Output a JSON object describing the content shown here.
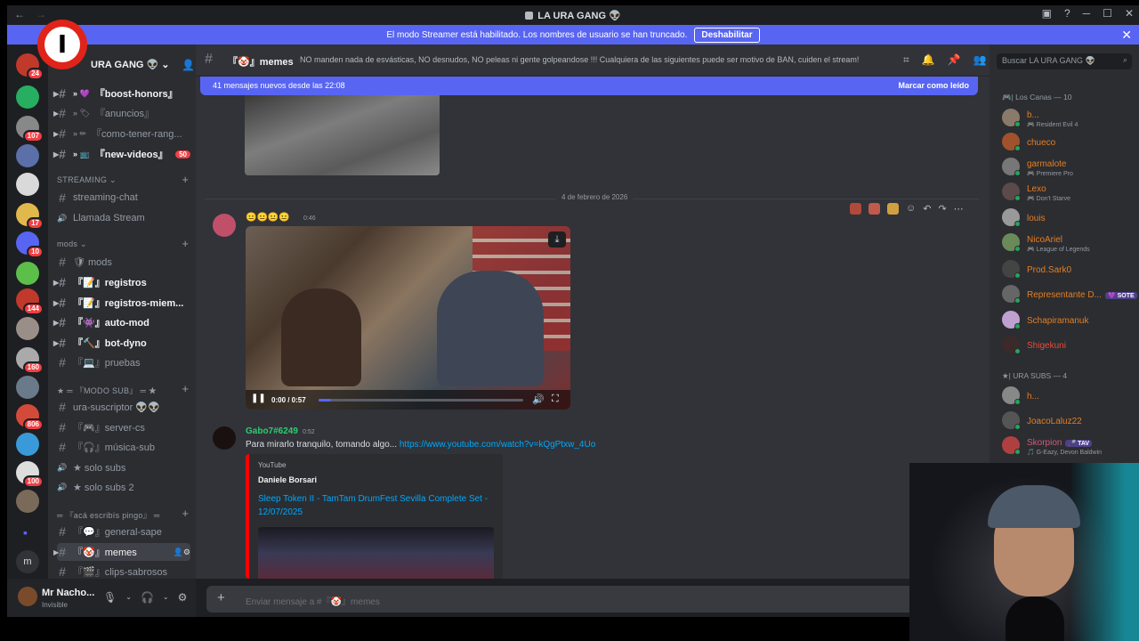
{
  "window": {
    "title": "LA URA GANG 👽",
    "back": "←",
    "forward": "→"
  },
  "banner": {
    "text": "El modo Streamer está habilitado. Los nombres de usuario se han truncado.",
    "button": "Deshabilitar",
    "close": "✕"
  },
  "guilds": [
    {
      "color": "#c0392b",
      "badge": "24"
    },
    {
      "color": "#27ae60",
      "badge": ""
    },
    {
      "color": "#888888",
      "badge": "107"
    },
    {
      "color": "#5b6fa8",
      "badge": ""
    },
    {
      "color": "#d9d9d9",
      "badge": ""
    },
    {
      "color": "#e1b84b",
      "badge": "17"
    },
    {
      "color": "#5865f2",
      "badge": "10"
    },
    {
      "color": "#5bbf4a",
      "badge": ""
    },
    {
      "color": "#c0392b",
      "badge": "144"
    },
    {
      "color": "#9a8f88",
      "badge": ""
    },
    {
      "color": "#aaaaaa",
      "badge": "160"
    },
    {
      "color": "#6a7a8a",
      "badge": ""
    },
    {
      "color": "#d44a3a",
      "badge": "806"
    },
    {
      "color": "#3a9ad9",
      "badge": ""
    },
    {
      "color": "#dddddd",
      "badge": "100"
    },
    {
      "color": "#7a6a5a",
      "badge": ""
    }
  ],
  "guild_extra": {
    "folder": "▪",
    "m": "m"
  },
  "server": {
    "name": "URA GANG 👽"
  },
  "sidebar": {
    "channels": [
      {
        "label": "『boost-honors』",
        "prefix": "» 💜",
        "unread": true
      },
      {
        "label": "『anuncios』",
        "prefix": "» 🏷",
        "unread": false
      },
      {
        "label": "『como-tener-rang...",
        "prefix": "» ✏",
        "unread": false
      },
      {
        "label": "『new-videos』",
        "prefix": "» 📺",
        "unread": true,
        "badge": "50"
      }
    ],
    "streaming_cat": "STREAMING ⌄",
    "streaming": [
      {
        "label": "streaming-chat",
        "icon": "#"
      },
      {
        "label": "Llamada Stream",
        "icon": "🔊"
      }
    ],
    "mods_cat": "mods ⌄",
    "mods": [
      {
        "label": "🛡 mods",
        "unread": false
      },
      {
        "label": "『📝』registros",
        "unread": true
      },
      {
        "label": "『📝』registros-miem...",
        "unread": true
      },
      {
        "label": "『👾』auto-mod",
        "unread": true
      },
      {
        "label": "『🔨』bot-dyno",
        "unread": true
      },
      {
        "label": "『💻』pruebas",
        "unread": false
      }
    ],
    "sub_cat": "★ ═ 『MODO SUB』 ═ ★",
    "sub": [
      {
        "label": "ura-suscriptor 👽👽",
        "icon": "#"
      },
      {
        "label": "『🎮』server-cs",
        "icon": "#"
      },
      {
        "label": "『🎧』música-sub",
        "icon": "#"
      },
      {
        "label": "★ solo subs",
        "icon": "🔊"
      },
      {
        "label": "★ solo subs 2",
        "icon": "🔊"
      }
    ],
    "pingo_cat": "═ 『acá escribís pingo』 ═",
    "pingo": [
      {
        "label": "『💬』general-sape",
        "active": false
      },
      {
        "label": "『🤡』memes",
        "active": true
      },
      {
        "label": "『🎬』clips-sabrosos",
        "active": false
      }
    ]
  },
  "user": {
    "name": "Mr Nacho...",
    "status": "Invisible"
  },
  "channel": {
    "name": "『🤡』memes",
    "topic": "NO manden nada de esvásticas, NO desnudos, NO peleas ni gente golpeandose !!! Cualquiera de las siguientes puede ser motivo de BAN, cuiden el stream!"
  },
  "chat": {
    "new_messages": "41 mensajes nuevos desde las 22:08",
    "mark_read": "Marcar como leído",
    "date_divider": "4 de febrero de 2026",
    "msg1": {
      "author": "😐😐😐😐",
      "time": "0:46"
    },
    "video": {
      "time": "0:00 / 0:57",
      "progress": 0.0
    },
    "msg2": {
      "author": "Gabo7#6249",
      "time": "0:52",
      "text": "Para mirarlo tranquilo, tomando algo...",
      "link": "https://www.youtube.com/watch?v=kQgPtxw_4Uo"
    },
    "embed": {
      "provider": "YouTube",
      "author": "Daniele Borsari",
      "title": "Sleep Token II - TamTam DrumFest Sevilla Complete Set - 12/07/2025"
    }
  },
  "composer": {
    "placeholder": "Enviar mensaje a #『🤡』memes"
  },
  "members": {
    "search_placeholder": "Buscar LA URA GANG 👽",
    "cat1": "🎮| Los Canas — 10",
    "group1": [
      {
        "name": "b...",
        "status": "🎮 Resident Evil 4",
        "color": "#e67e22",
        "ava": "#8a7a6a"
      },
      {
        "name": "chueco",
        "status": "",
        "color": "#e67e22",
        "ava": "#a0522d"
      },
      {
        "name": "garmalote",
        "status": "🎮 Premiere Pro",
        "color": "#e67e22",
        "ava": "#777777"
      },
      {
        "name": "Lexo",
        "status": "🎮 Don't Starve",
        "color": "#e67e22",
        "ava": "#5a4a4a"
      },
      {
        "name": "louis",
        "status": "",
        "color": "#e67e22",
        "ava": "#999999"
      },
      {
        "name": "NicoAriel",
        "status": "🎮 League of Legends",
        "color": "#e67e22",
        "ava": "#6a8a5a"
      },
      {
        "name": "Prod.Sark0",
        "status": "",
        "color": "#e67e22",
        "ava": "#444444"
      },
      {
        "name": "Representante D...",
        "status": "",
        "color": "#e67e22",
        "ava": "#666666",
        "tag": "💜 SOTE"
      },
      {
        "name": "Schapiramanuk",
        "status": "",
        "color": "#e67e22",
        "ava": "#c0a0d0"
      },
      {
        "name": "Shigekuni",
        "status": "",
        "color": "#e74c3c",
        "ava": "#3a2a2a"
      }
    ],
    "cat2": "★| URA SUBS — 4",
    "group2": [
      {
        "name": "h...",
        "status": "",
        "color": "#e67e22",
        "ava": "#888888"
      },
      {
        "name": "JoacoLaluz22",
        "status": "",
        "color": "#e67e22",
        "ava": "#555555"
      },
      {
        "name": "Skorpion",
        "status": "🎵 G-Eazy, Devon Baldwin",
        "color": "#d05a7a",
        "ava": "#b04040",
        "tag": "🎤 TAV"
      }
    ]
  },
  "overlay": {
    "logo_letter": "I"
  }
}
